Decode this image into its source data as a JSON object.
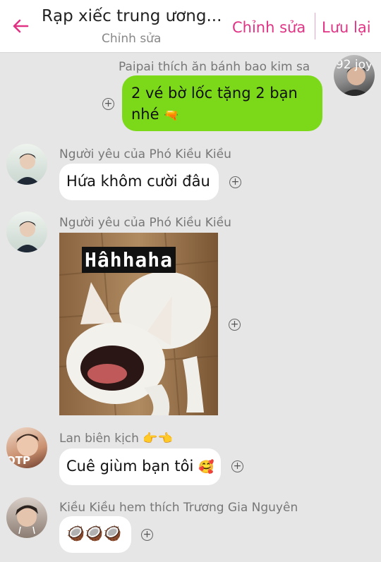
{
  "header": {
    "title": "Rạp xiếc trung ương...",
    "subtitle": "Chỉnh sửa",
    "edit_label": "Chỉnh sửa",
    "save_label": "Lưu lại",
    "accent_color": "#e03384"
  },
  "messages": [
    {
      "sender": "Paipai thích ăn bánh bao kim sa",
      "avatar_text": "92 joy",
      "line1": "2 vé bờ lốc tặng 2 bạn",
      "line2": "nhé",
      "emoji": "🔫",
      "bubble_color": "#7bd91a"
    },
    {
      "sender": "Người yêu của Phó Kiều Kiều",
      "text": "Hứa khôm cười đâu"
    },
    {
      "sender": "Người yêu của Phó Kiều Kiều",
      "image_caption": "Hâhhaha"
    },
    {
      "sender": "Lan biên kịch",
      "sender_emoji": "👉👈",
      "avatar_text": "OTP",
      "text": "Cuê giùm bạn tôi",
      "emoji": "🥰"
    },
    {
      "sender": "Kiều Kiều hem thích Trương Gia Nguyên",
      "emoji": "🥥🥥🥥"
    }
  ],
  "add_reaction_symbol": "+"
}
